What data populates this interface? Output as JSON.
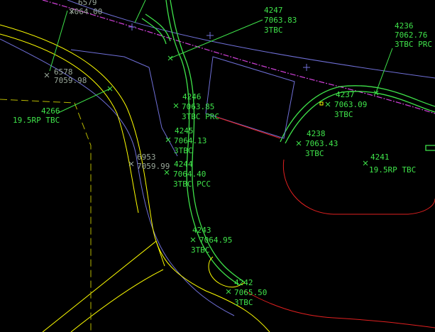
{
  "drawing": {
    "background": "#000000",
    "colors": {
      "curb": "#3fe34a",
      "leader": "#3fe34a",
      "edge_of_pavement": "#ffff00",
      "centerline": "#7070d8",
      "property_line": "#d040d8",
      "red_line": "#e02020",
      "gray_text": "#9aa89a",
      "dashed_line": "#b8b800"
    },
    "points": [
      {
        "id": "6579",
        "elev": "7064.00",
        "desc": "",
        "tone": "gray"
      },
      {
        "id": "4247",
        "elev": "7063.83",
        "desc": "3TBC",
        "tone": "green"
      },
      {
        "id": "4236",
        "elev": "7062.76",
        "desc": "3TBC PRC",
        "tone": "green"
      },
      {
        "id": "6578",
        "elev": "7059.98",
        "desc": "",
        "tone": "gray"
      },
      {
        "id": "4266",
        "elev": "",
        "desc": "19.5RP TBC",
        "tone": "green"
      },
      {
        "id": "4237",
        "elev": "7063.09",
        "desc": "3TBC",
        "tone": "green"
      },
      {
        "id": "4246",
        "elev": "7063.85",
        "desc": "3TBC PRC",
        "tone": "green"
      },
      {
        "id": "4238",
        "elev": "7063.43",
        "desc": "3TBC",
        "tone": "green"
      },
      {
        "id": "4245",
        "elev": "7064.13",
        "desc": "3TBC",
        "tone": "green"
      },
      {
        "id": "4241",
        "elev": "",
        "desc": "19.5RP TBC",
        "tone": "green"
      },
      {
        "id": "6953",
        "elev": "7059.99",
        "desc": "",
        "tone": "gray"
      },
      {
        "id": "4244",
        "elev": "7064.40",
        "desc": "3TBC PCC",
        "tone": "green"
      },
      {
        "id": "4243",
        "elev": "7064.95",
        "desc": "3TBC",
        "tone": "green"
      },
      {
        "id": "4242",
        "elev": "7065.50",
        "desc": "3TBC",
        "tone": "green"
      }
    ]
  }
}
